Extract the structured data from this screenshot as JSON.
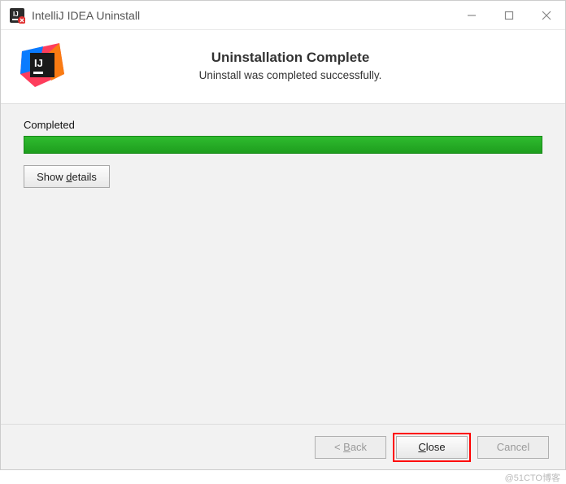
{
  "window": {
    "title": "IntelliJ IDEA Uninstall"
  },
  "header": {
    "title": "Uninstallation Complete",
    "subtitle": "Uninstall was completed successfully."
  },
  "body": {
    "status_label": "Completed",
    "progress_percent": 100,
    "show_details_label": "Show details",
    "show_details_accel": "d"
  },
  "footer": {
    "back_label": "< Back",
    "back_accel": "B",
    "close_label": "Close",
    "close_accel": "C",
    "cancel_label": "Cancel"
  },
  "colors": {
    "progress_green": "#22a822",
    "highlight_red": "#ff0000"
  },
  "watermark": "@51CTO博客"
}
